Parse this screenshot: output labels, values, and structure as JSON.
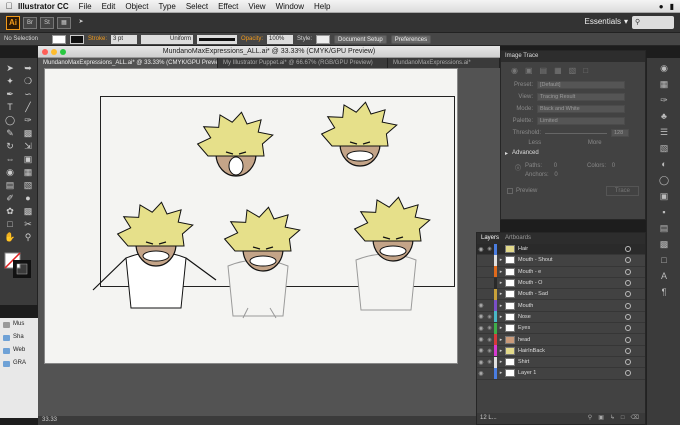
{
  "menubar": {
    "app": "Illustrator CC",
    "items": [
      "File",
      "Edit",
      "Object",
      "Type",
      "Select",
      "Effect",
      "View",
      "Window",
      "Help"
    ]
  },
  "appbar": {
    "logo": "Ai",
    "workspace": "Essentials",
    "search_placeholder": "",
    "buttons": [
      "Br",
      "St"
    ]
  },
  "control": {
    "selection": "No Selection",
    "stroke_label": "Stroke:",
    "stroke_value": "3 pt",
    "profile": "Uniform",
    "opacity_label": "Opacity:",
    "opacity_value": "100%",
    "style_label": "Style:",
    "doc_setup": "Document Setup",
    "preferences": "Preferences"
  },
  "document": {
    "window_title": "MundanoMaxExpressions_ALL.ai* @ 33.33% (CMYK/GPU Preview)",
    "tabs": [
      "MundanoMaxExpressions_ALL.ai* @ 33.33% (CMYK/GPU Preview)",
      "My Illustrator Puppet.ai* @ 66.67% (RGB/GPU Preview)",
      "MundanoMaxExpressions.ai*"
    ],
    "zoom_status": "33.33"
  },
  "finder": {
    "items": [
      "Mus",
      "Sha",
      "Web",
      "GRA"
    ]
  },
  "image_trace": {
    "title": "Image Trace",
    "preset_label": "Preset:",
    "preset_value": "[Default]",
    "view_label": "View:",
    "view_value": "Tracing Result",
    "mode_label": "Mode:",
    "mode_value": "Black and White",
    "palette_label": "Palette:",
    "palette_value": "Limited",
    "threshold_label": "Threshold:",
    "threshold_value": "128",
    "less": "Less",
    "more": "More",
    "advanced": "Advanced",
    "paths_label": "Paths:",
    "paths_value": "0",
    "colors_label": "Colors:",
    "colors_value": "0",
    "anchors_label": "Anchors:",
    "anchors_value": "0",
    "preview": "Preview",
    "trace_button": "Trace"
  },
  "layers": {
    "tabs": [
      "Layers",
      "Artboards"
    ],
    "rows": [
      {
        "name": "Hair",
        "color": "#4a7de0",
        "sel": true,
        "eye": true,
        "lock": true,
        "tri": false,
        "thumb": "#e3da8b"
      },
      {
        "name": "Mouth - Shout",
        "color": "#e0e0e0",
        "sel": false,
        "eye": false,
        "lock": false,
        "tri": true,
        "thumb": "#ffffff"
      },
      {
        "name": "Mouth - e",
        "color": "#e06a1c",
        "sel": false,
        "eye": false,
        "lock": false,
        "tri": true,
        "thumb": "#ffffff"
      },
      {
        "name": "Mouth - O",
        "color": "#2a2a2a",
        "sel": false,
        "eye": false,
        "lock": false,
        "tri": true,
        "thumb": "#ffffff"
      },
      {
        "name": "Mouth - Sad",
        "color": "#c9a23a",
        "sel": false,
        "eye": false,
        "lock": false,
        "tri": true,
        "thumb": "#ffffff"
      },
      {
        "name": "Mouth",
        "color": "#7a4fc7",
        "sel": false,
        "eye": true,
        "lock": false,
        "tri": true,
        "thumb": "#ffffff"
      },
      {
        "name": "Nose",
        "color": "#49b6c7",
        "sel": false,
        "eye": true,
        "lock": true,
        "tri": true,
        "thumb": "#ffffff"
      },
      {
        "name": "Eyes",
        "color": "#3fae49",
        "sel": false,
        "eye": true,
        "lock": true,
        "tri": true,
        "thumb": "#ffffff"
      },
      {
        "name": "head",
        "color": "#d63a3a",
        "sel": false,
        "eye": true,
        "lock": true,
        "tri": true,
        "thumb": "#c99a7a"
      },
      {
        "name": "HairInBack",
        "color": "#d63ad0",
        "sel": false,
        "eye": true,
        "lock": true,
        "tri": true,
        "thumb": "#e3da8b"
      },
      {
        "name": "Shirt",
        "color": "#e0e0e0",
        "sel": false,
        "eye": true,
        "lock": true,
        "tri": true,
        "thumb": "#ffffff"
      },
      {
        "name": "Layer 1",
        "color": "#4a7de0",
        "sel": false,
        "eye": true,
        "lock": false,
        "tri": true,
        "thumb": "#ffffff"
      }
    ],
    "count": "12 L..."
  },
  "colors": {
    "hair": "#e6e08a",
    "skin": "#c4a488",
    "accent": "#f29a1a"
  }
}
